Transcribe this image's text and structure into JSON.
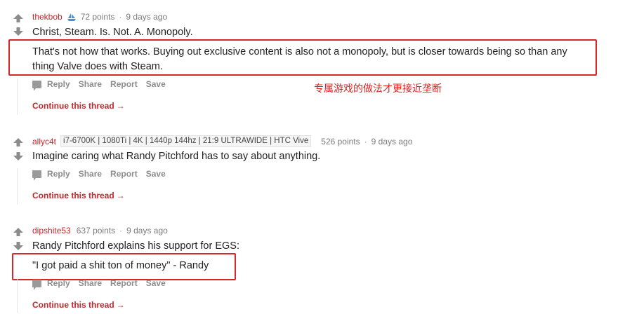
{
  "comments": [
    {
      "author": "thekbob",
      "has_mod_icon": true,
      "points": "72 points",
      "age": "9 days ago",
      "body_line1": "Christ, Steam. Is. Not. A. Monopoly.",
      "reply_line1": "That's not how that works. Buying out exclusive content is also not a monopoly, but is closer towards being so than any",
      "reply_line2": "thing Valve does with Steam.",
      "actions": {
        "reply": "Reply",
        "share": "Share",
        "report": "Report",
        "save": "Save"
      },
      "continue": "Continue this thread"
    },
    {
      "author": "allyc4t",
      "flair": "i7-6700K | 1080Ti | 4K | 1440p 144hz | 21:9 ULTRAWIDE | HTC Vive",
      "points": "526 points",
      "age": "9 days ago",
      "body_line1": "Imagine caring what Randy Pitchford has to say about anything.",
      "actions": {
        "reply": "Reply",
        "share": "Share",
        "report": "Report",
        "save": "Save"
      },
      "continue": "Continue this thread"
    },
    {
      "author": "dipshite53",
      "points": "637 points",
      "age": "9 days ago",
      "body_line1": "Randy Pitchford explains his support for EGS:",
      "body_line2": "\"I got paid a shit ton of money\" - Randy",
      "actions": {
        "reply": "Reply",
        "share": "Share",
        "report": "Report",
        "save": "Save"
      },
      "continue": "Continue this thread"
    }
  ],
  "annotation": "专属游戏的做法才更接近垄断",
  "colors": {
    "author": "#c6272a",
    "highlight_box": "#d92626",
    "annotation": "#e02020"
  },
  "separator": "·",
  "continue_arrow": "→"
}
